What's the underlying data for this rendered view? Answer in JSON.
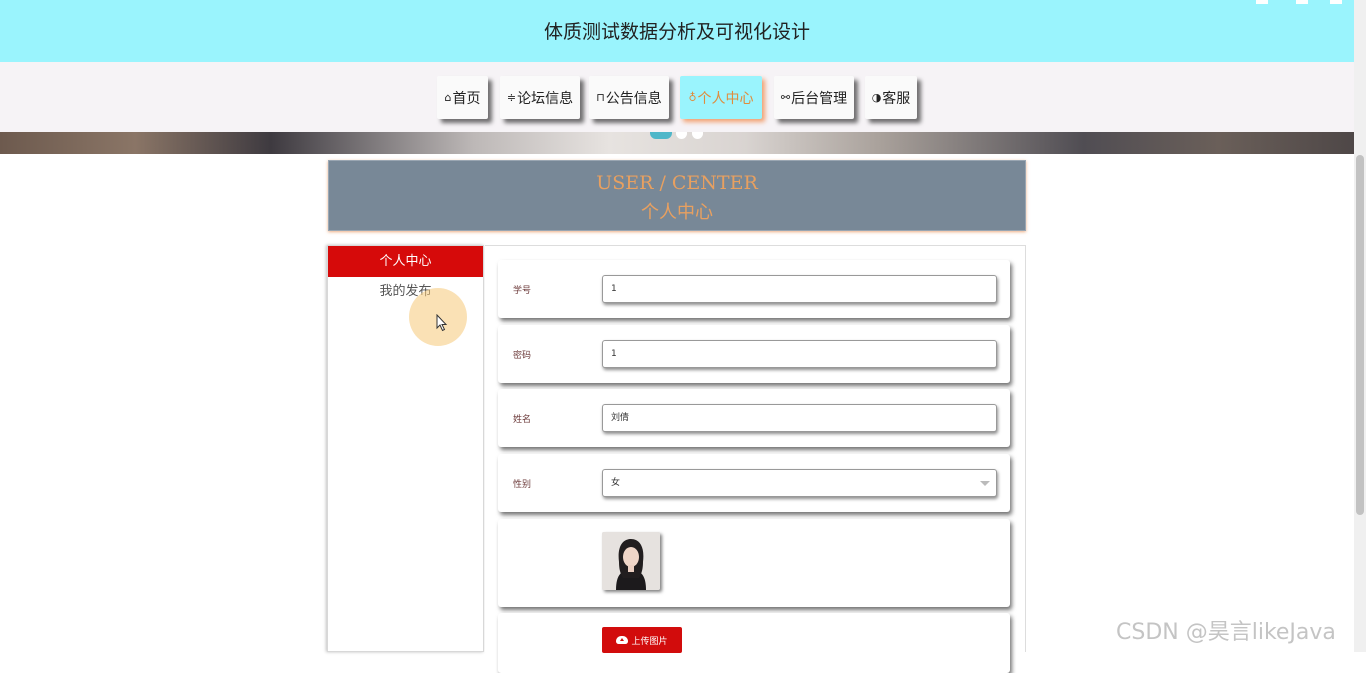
{
  "header": {
    "title": "体质测试数据分析及可视化设计"
  },
  "nav": {
    "items": [
      {
        "icon": "⌂",
        "label": "首页"
      },
      {
        "icon": "≑",
        "label": "论坛信息"
      },
      {
        "icon": "⊓",
        "label": "公告信息"
      },
      {
        "icon": "♁",
        "label": "个人中心",
        "active": true
      },
      {
        "icon": "⚯",
        "label": "后台管理"
      },
      {
        "icon": "◑",
        "label": "客服"
      }
    ]
  },
  "page_title": {
    "english": "USER / CENTER",
    "chinese": "个人中心"
  },
  "sidebar": {
    "active_item": "个人中心",
    "item_2": "我的发布"
  },
  "form": {
    "student_id": {
      "label": "学号",
      "value": "1"
    },
    "password": {
      "label": "密码",
      "value": "1"
    },
    "name": {
      "label": "姓名",
      "value": "刘倩"
    },
    "gender": {
      "label": "性别",
      "value": "女"
    },
    "upload_label": "上传图片"
  },
  "watermark": "CSDN @昊言likeJava",
  "colors": {
    "header_bg": "#9af4fd",
    "accent_red": "#d60a0a",
    "title_panel": "#788897",
    "title_text": "#e8a060"
  }
}
